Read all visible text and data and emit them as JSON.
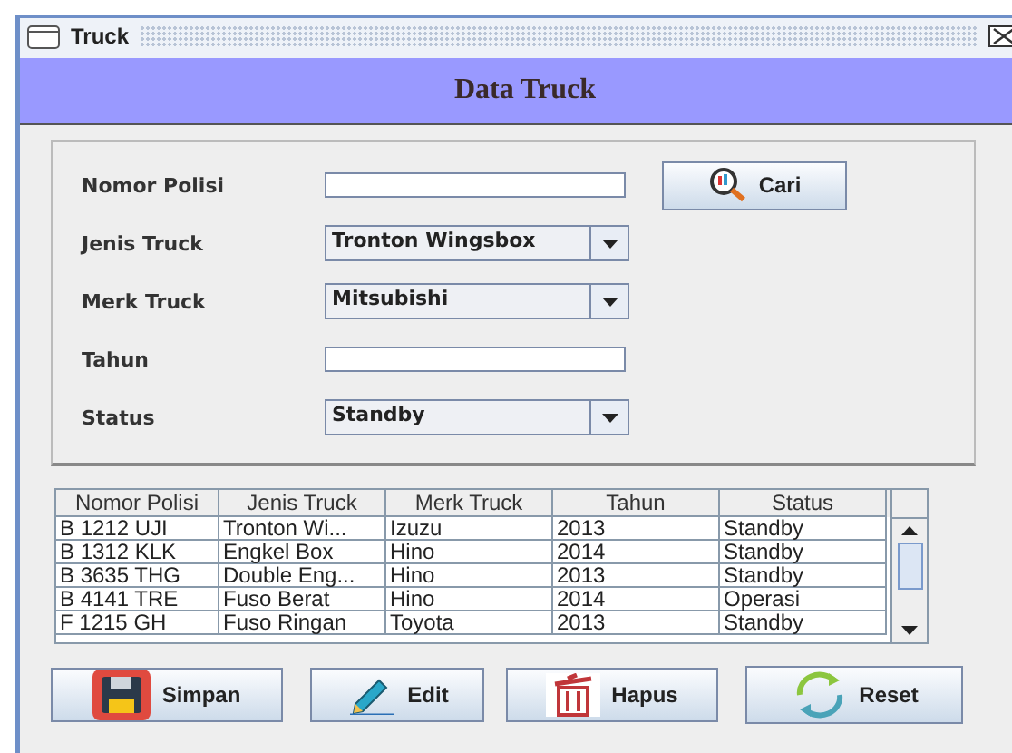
{
  "window": {
    "title": "Truck"
  },
  "header": {
    "title": "Data Truck"
  },
  "form": {
    "fields": [
      {
        "kind": "text",
        "label": "Nomor Polisi"
      },
      {
        "kind": "combo",
        "label": "Jenis Truck",
        "value": "Tronton Wingsbox"
      },
      {
        "kind": "combo",
        "label": "Merk Truck",
        "value": "Mitsubishi"
      },
      {
        "kind": "text",
        "label": "Tahun"
      },
      {
        "kind": "combo",
        "label": "Status",
        "value": "Standby"
      }
    ],
    "search_button": "Cari"
  },
  "table": {
    "columns": [
      "Nomor Polisi",
      "Jenis Truck",
      "Merk Truck",
      "Tahun",
      "Status"
    ],
    "rows": [
      [
        "B 1212 UJI",
        "Tronton Wi...",
        "Izuzu",
        "2013",
        "Standby"
      ],
      [
        "B 1312 KLK",
        "Engkel Box",
        "Hino",
        "2014",
        "Standby"
      ],
      [
        "B 3635 THG",
        "Double Eng...",
        "Hino",
        "2013",
        "Standby"
      ],
      [
        "B 4141 TRE",
        "Fuso Berat",
        "Hino",
        "2014",
        "Operasi"
      ],
      [
        "F 1215 GH",
        "Fuso Ringan",
        "Toyota",
        "2013",
        "Standby"
      ]
    ]
  },
  "buttons": [
    {
      "kind": "save",
      "label": "Simpan"
    },
    {
      "kind": "edit",
      "label": "Edit"
    },
    {
      "kind": "delete",
      "label": "Hapus"
    },
    {
      "kind": "reset",
      "label": "Reset"
    }
  ]
}
